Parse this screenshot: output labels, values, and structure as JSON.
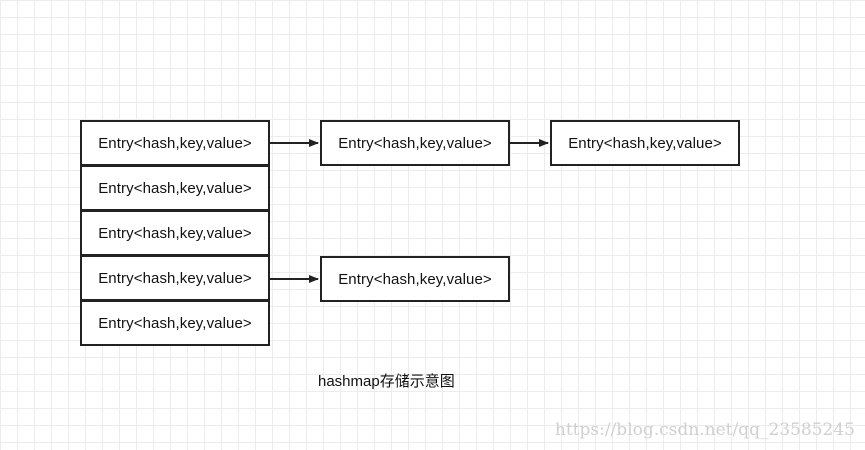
{
  "buckets": [
    {
      "label": "Entry<hash,key,value>"
    },
    {
      "label": "Entry<hash,key,value>"
    },
    {
      "label": "Entry<hash,key,value>"
    },
    {
      "label": "Entry<hash,key,value>"
    },
    {
      "label": "Entry<hash,key,value>"
    }
  ],
  "chains": {
    "bucket_0": [
      {
        "label": "Entry<hash,key,value>"
      },
      {
        "label": "Entry<hash,key,value>"
      }
    ],
    "bucket_3": [
      {
        "label": "Entry<hash,key,value>"
      }
    ]
  },
  "caption": "hashmap存储示意图",
  "watermark": "https://blog.csdn.net/qq_23585245",
  "colors": {
    "stroke": "#222222",
    "grid": "#ececec",
    "node_fill": "#ffffff"
  }
}
